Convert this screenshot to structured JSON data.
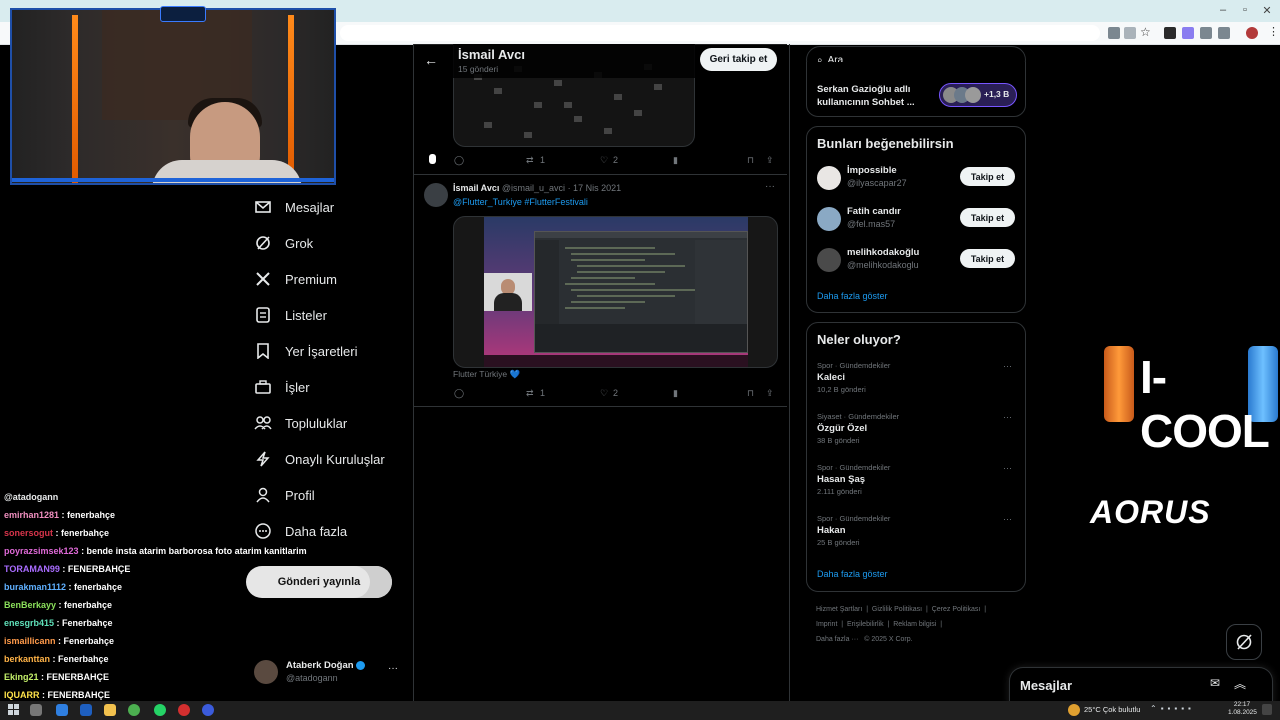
{
  "browser": {
    "address": ""
  },
  "left_nav": {
    "items": [
      {
        "key": "messages",
        "label": "Mesajlar",
        "icon": "mail-icon"
      },
      {
        "key": "grok",
        "label": "Grok",
        "icon": "grok-icon"
      },
      {
        "key": "premium",
        "label": "Premium",
        "icon": "x-logo-icon"
      },
      {
        "key": "lists",
        "label": "Listeler",
        "icon": "list-icon"
      },
      {
        "key": "bookmarks",
        "label": "Yer İşaretleri",
        "icon": "bookmark-icon"
      },
      {
        "key": "jobs",
        "label": "İşler",
        "icon": "briefcase-icon"
      },
      {
        "key": "communities",
        "label": "Topluluklar",
        "icon": "people-icon"
      },
      {
        "key": "verified",
        "label": "Onaylı Kuruluşlar",
        "icon": "lightning-icon"
      },
      {
        "key": "profile",
        "label": "Profil",
        "icon": "person-icon"
      },
      {
        "key": "more",
        "label": "Daha fazla",
        "icon": "more-circle-icon"
      }
    ],
    "post_button": "Gönderi yayınla",
    "account": {
      "name": "Ataberk Doğan",
      "handle": "@atadogann"
    }
  },
  "chat": [
    {
      "user": "@atadogann",
      "message": "",
      "color": "#e7e9ea"
    },
    {
      "user": "emirhan1281",
      "message": " : fenerbahçe",
      "color": "#f08fbf"
    },
    {
      "user": "sonersogut",
      "message": " : fenerbahçe",
      "color": "#d8344b"
    },
    {
      "user": "poyrazsimsek123",
      "message": " : bende insta atarim barborosa foto atarim kanitlarim",
      "color": "#e06ad8"
    },
    {
      "user": "TORAMAN99",
      "message": " : FENERBAHÇE",
      "color": "#a96cff"
    },
    {
      "user": "burakman1112",
      "message": " : fenerbahçe",
      "color": "#5fb0ff"
    },
    {
      "user": "BenBerkayy",
      "message": " : fenerbahçe",
      "color": "#8be05b"
    },
    {
      "user": "enesgrb415",
      "message": " : Fenerbahçe",
      "color": "#5fe0b9"
    },
    {
      "user": "ismaillicann",
      "message": " : Fenerbahçe",
      "color": "#ff9a4a"
    },
    {
      "user": "berkanttan",
      "message": " : Fenerbahçe",
      "color": "#ffb347"
    },
    {
      "user": "Eking21",
      "message": " : FENERBAHÇE",
      "color": "#c4f06a"
    },
    {
      "user": "IQUARR",
      "message": " : FENERBAHÇE",
      "color": "#ffe34a"
    }
  ],
  "profile_header": {
    "name": "İsmail Avcı",
    "posts": "15 gönderi",
    "unfollow": "Geri takip et"
  },
  "post1": {
    "replies": "",
    "reposts": "1",
    "likes": "2"
  },
  "post2": {
    "name": "İsmail Avcı",
    "handle": "@ismail_u_avci",
    "date": "· 17 Nis 2021",
    "hashtags": "@Flutter_Turkiye #FlutterFestivali",
    "caption": "Flutter Türkiye 💙",
    "replies": "",
    "reposts": "1",
    "likes": "2"
  },
  "right": {
    "search_placeholder": "Ara",
    "chat_card": {
      "top": "Serkan Gazioğlu adlı",
      "bottom": "kullanıcının Sohbet ...",
      "count": "+1,3 B"
    },
    "suggestions": {
      "title": "Bunları beğenebilirsin",
      "items": [
        {
          "name": "İmpossible",
          "handle": "@ilyascapar27",
          "button": "Takip et"
        },
        {
          "name": "Fatih candır",
          "handle": "@fel.mas57",
          "button": "Takip et"
        },
        {
          "name": "melihkodakoğlu",
          "handle": "@melihkodakoglu",
          "button": "Takip et"
        }
      ],
      "more": "Daha fazla göster"
    },
    "trends": {
      "title": "Neler oluyor?",
      "items": [
        {
          "meta": "Spor · Gündemdekiler",
          "name": "Kaleci",
          "posts": "10,2 B gönderi"
        },
        {
          "meta": "Siyaset · Gündemdekiler",
          "name": "Özgür Özel",
          "posts": "38 B gönderi"
        },
        {
          "meta": "Spor · Gündemdekiler",
          "name": "Hasan Şaş",
          "posts": "2.111 gönderi"
        },
        {
          "meta": "Spor · Gündemdekiler",
          "name": "Hakan",
          "posts": "25 B gönderi"
        }
      ],
      "more": "Daha fazla göster"
    },
    "footer": {
      "links": [
        "Hizmet Şartları",
        "|",
        "Gizlilik Politikası",
        "|",
        "Çerez Politikası",
        "|",
        "Imprint",
        "|",
        "Erişilebilirlik",
        "|",
        "Reklam bilgisi",
        "|",
        "Daha fazla ···",
        "© 2025 X Corp."
      ]
    },
    "messages_drawer": "Mesajlar"
  },
  "overlay": {
    "brand1": "I-COOL",
    "brand2": "AORUS"
  },
  "taskbar": {
    "weather": "25°C  Çok bulutlu",
    "time": "22:17",
    "date": "1.08.2025"
  }
}
